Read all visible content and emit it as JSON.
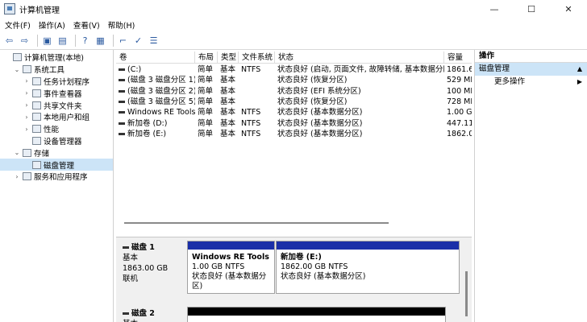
{
  "window": {
    "title": "计算机管理",
    "min": "—",
    "max": "☐",
    "close": "✕"
  },
  "menu": [
    "文件(F)",
    "操作(A)",
    "查看(V)",
    "帮助(H)"
  ],
  "toolbar": [
    "back-icon",
    "forward-icon",
    "up-folder-icon",
    "show-hide-tree-icon",
    "help-icon",
    "properties-icon",
    "connect-icon",
    "check-icon",
    "list-icon"
  ],
  "tree": [
    {
      "label": "计算机管理(本地)",
      "level": 0,
      "exp": "",
      "icon": "computer-icon"
    },
    {
      "label": "系统工具",
      "level": 1,
      "exp": "⌄",
      "icon": "tools-icon"
    },
    {
      "label": "任务计划程序",
      "level": 2,
      "exp": "›",
      "icon": "clock-icon"
    },
    {
      "label": "事件查看器",
      "level": 2,
      "exp": "›",
      "icon": "event-icon"
    },
    {
      "label": "共享文件夹",
      "level": 2,
      "exp": "›",
      "icon": "share-icon"
    },
    {
      "label": "本地用户和组",
      "level": 2,
      "exp": "›",
      "icon": "users-icon"
    },
    {
      "label": "性能",
      "level": 2,
      "exp": "›",
      "icon": "performance-icon"
    },
    {
      "label": "设备管理器",
      "level": 2,
      "exp": "",
      "icon": "device-icon"
    },
    {
      "label": "存储",
      "level": 1,
      "exp": "⌄",
      "icon": "storage-icon"
    },
    {
      "label": "磁盘管理",
      "level": 2,
      "exp": "",
      "icon": "disk-icon",
      "selected": true
    },
    {
      "label": "服务和应用程序",
      "level": 1,
      "exp": "›",
      "icon": "services-icon"
    }
  ],
  "columns": [
    "卷",
    "布局",
    "类型",
    "文件系统",
    "状态",
    "容量"
  ],
  "volumes": [
    {
      "vol": "(C:)",
      "layout": "简单",
      "type": "基本",
      "fs": "NTFS",
      "status": "状态良好 (启动, 页面文件, 故障转储, 基本数据分区)",
      "cap": "1861.6"
    },
    {
      "vol": "(磁盘 3 磁盘分区 1)",
      "layout": "简单",
      "type": "基本",
      "fs": "",
      "status": "状态良好 (恢复分区)",
      "cap": "529 MI"
    },
    {
      "vol": "(磁盘 3 磁盘分区 2)",
      "layout": "简单",
      "type": "基本",
      "fs": "",
      "status": "状态良好 (EFI 系统分区)",
      "cap": "100 MI"
    },
    {
      "vol": "(磁盘 3 磁盘分区 5)",
      "layout": "简单",
      "type": "基本",
      "fs": "",
      "status": "状态良好 (恢复分区)",
      "cap": "728 MI"
    },
    {
      "vol": "Windows RE Tools",
      "layout": "简单",
      "type": "基本",
      "fs": "NTFS",
      "status": "状态良好 (基本数据分区)",
      "cap": "1.00 GI"
    },
    {
      "vol": "新加卷 (D:)",
      "layout": "简单",
      "type": "基本",
      "fs": "NTFS",
      "status": "状态良好 (基本数据分区)",
      "cap": "447.11"
    },
    {
      "vol": "新加卷 (E:)",
      "layout": "简单",
      "type": "基本",
      "fs": "NTFS",
      "status": "状态良好 (基本数据分区)",
      "cap": "1862.0"
    }
  ],
  "disks": [
    {
      "name": "磁盘 1",
      "type": "基本",
      "size": "1863.00 GB",
      "state": "联机",
      "partitions": [
        {
          "name": "Windows RE Tools",
          "size": "1.00 GB NTFS",
          "status": "状态良好 (基本数据分区)"
        },
        {
          "name": "新加卷  (E:)",
          "size": "1862.00 GB NTFS",
          "status": "状态良好 (基本数据分区)"
        }
      ]
    },
    {
      "name": "磁盘 2",
      "type": "基本"
    }
  ],
  "actions": {
    "header": "操作",
    "section": "磁盘管理",
    "more": "更多操作"
  }
}
